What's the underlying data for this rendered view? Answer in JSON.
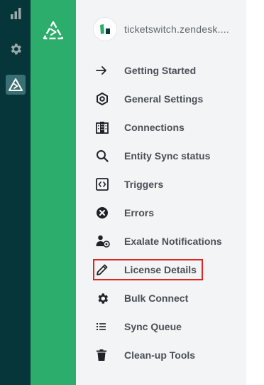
{
  "account": {
    "name": "ticketswitch.zendesk...."
  },
  "menu": {
    "items": [
      {
        "label": "Getting Started",
        "icon": "arrow-right-icon"
      },
      {
        "label": "General Settings",
        "icon": "hexagon-settings-icon"
      },
      {
        "label": "Connections",
        "icon": "building-icon"
      },
      {
        "label": "Entity Sync status",
        "icon": "search-icon"
      },
      {
        "label": "Triggers",
        "icon": "code-box-icon"
      },
      {
        "label": "Errors",
        "icon": "error-circle-icon"
      },
      {
        "label": "Exalate Notifications",
        "icon": "user-at-icon"
      },
      {
        "label": "License Details",
        "icon": "pencil-icon",
        "highlighted": true
      },
      {
        "label": "Bulk Connect",
        "icon": "gear-icon"
      },
      {
        "label": "Sync Queue",
        "icon": "list-icon"
      },
      {
        "label": "Clean-up Tools",
        "icon": "trash-icon"
      }
    ]
  },
  "colors": {
    "rail": "#07363a",
    "appbar": "#2cad6b",
    "panel": "#f3f4f6",
    "highlight_border": "#e02424"
  }
}
